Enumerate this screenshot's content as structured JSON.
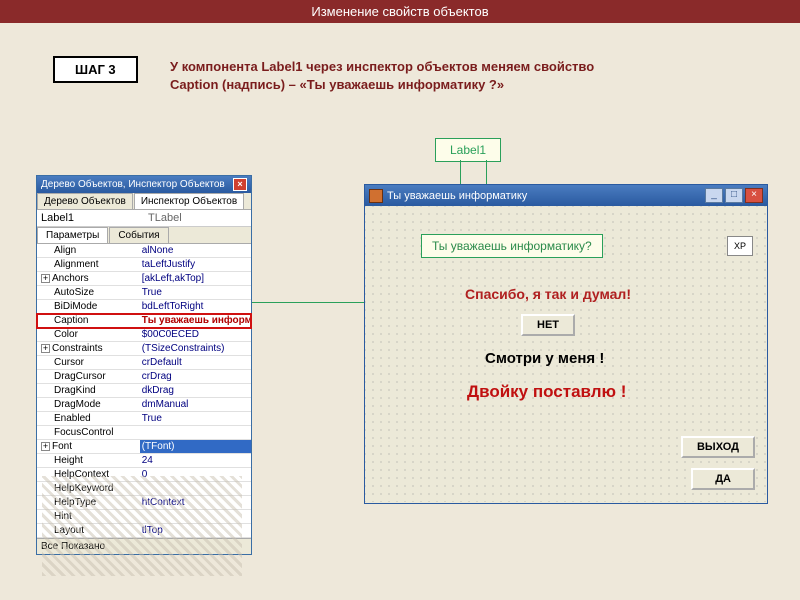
{
  "page": {
    "title": "Изменение свойств объектов",
    "step_label": "ШАГ 3",
    "instruction": "У компонента Label1 через инспектор объектов меняем свойство Caption (надпись) – «Ты уважаешь информатику ?»",
    "label1_callout": "Label1"
  },
  "inspector": {
    "title": "Дерево Объектов, Инспектор Объектов",
    "tabs": {
      "tree": "Дерево Объектов",
      "insp": "Инспектор Объектов"
    },
    "object": {
      "name": "Label1",
      "type": "TLabel"
    },
    "subtabs": {
      "params": "Параметры",
      "events": "События"
    },
    "props": [
      {
        "k": "Align",
        "v": "alNone"
      },
      {
        "k": "Alignment",
        "v": "taLeftJustify"
      },
      {
        "k": "Anchors",
        "v": "[akLeft,akTop]",
        "expand": "+"
      },
      {
        "k": "AutoSize",
        "v": "True"
      },
      {
        "k": "BiDiMode",
        "v": "bdLeftToRight"
      },
      {
        "k": "Caption",
        "v": "Ты уважаешь информатику?",
        "highlight": true
      },
      {
        "k": "Color",
        "v": "$00C0ECED"
      },
      {
        "k": "Constraints",
        "v": "(TSizeConstraints)",
        "expand": "+"
      },
      {
        "k": "Cursor",
        "v": "crDefault"
      },
      {
        "k": "DragCursor",
        "v": "crDrag"
      },
      {
        "k": "DragKind",
        "v": "dkDrag"
      },
      {
        "k": "DragMode",
        "v": "dmManual"
      },
      {
        "k": "Enabled",
        "v": "True"
      },
      {
        "k": "FocusControl",
        "v": ""
      },
      {
        "k": "Font",
        "v": "(TFont)",
        "expand": "+",
        "selected": true
      },
      {
        "k": "Height",
        "v": "24"
      },
      {
        "k": "HelpContext",
        "v": "0"
      },
      {
        "k": "HelpKeyword",
        "v": ""
      },
      {
        "k": "HelpType",
        "v": "htContext"
      },
      {
        "k": "Hint",
        "v": ""
      },
      {
        "k": "Layout",
        "v": "tlTop"
      }
    ],
    "footer": "Все Показано"
  },
  "app": {
    "title": "Ты уважаешь информатику",
    "label_question": "Ты уважаешь информатику?",
    "text_thanks": "Спасибо, я так и думал!",
    "btn_net": "НЕТ",
    "text_look": "Смотри у меня !",
    "text_two": "Двойку поставлю !",
    "btn_exit": "ВЫХОД",
    "btn_da": "ДА",
    "xp": "XP",
    "win_min": "_",
    "win_max": "□",
    "win_close": "×"
  }
}
